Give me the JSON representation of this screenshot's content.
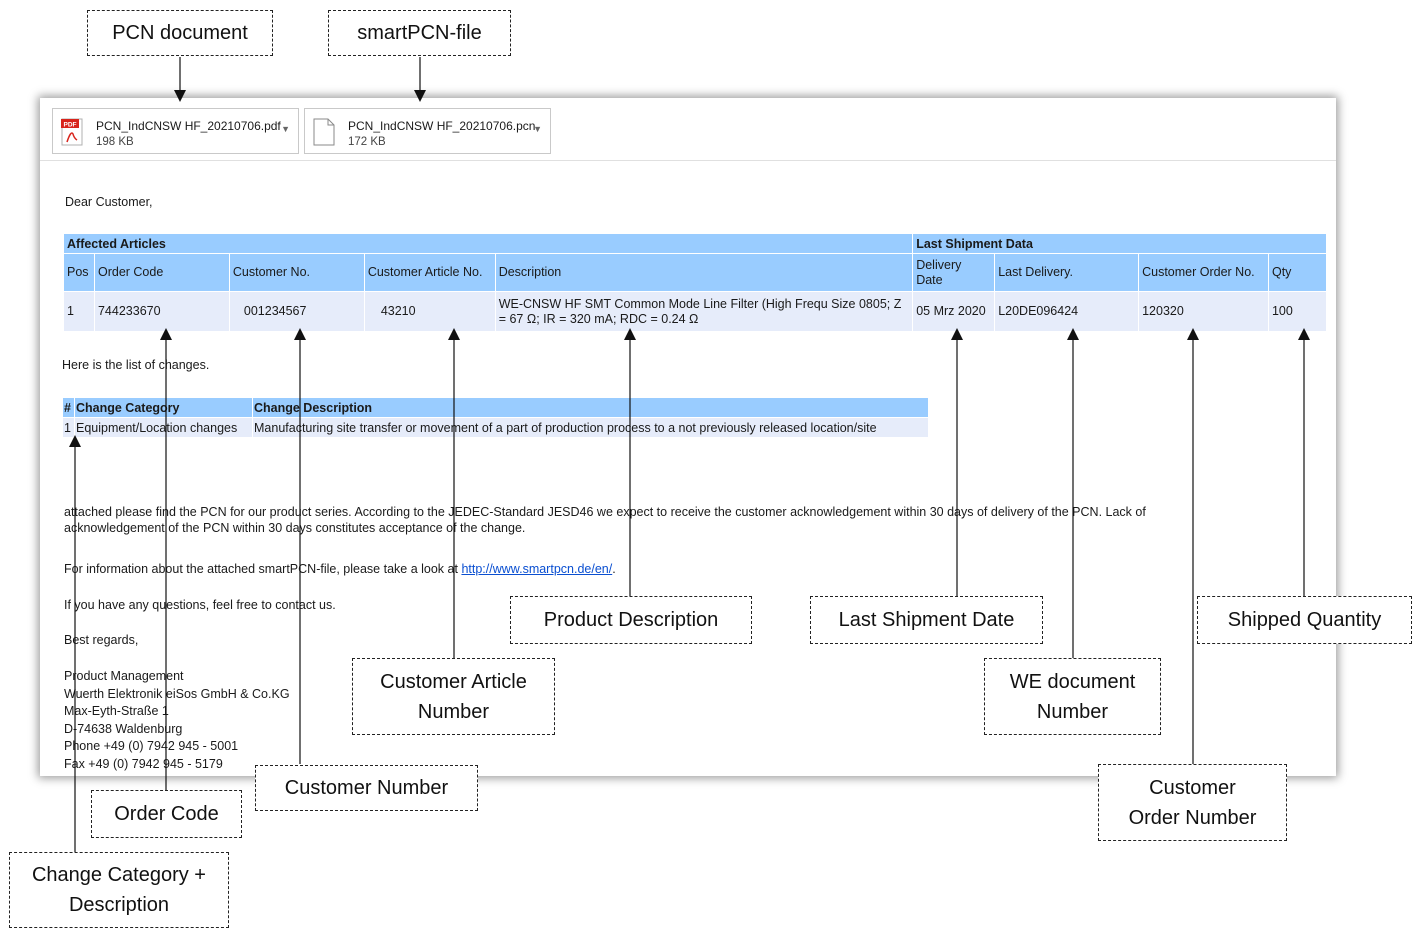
{
  "attachments": [
    {
      "name": "PCN_IndCNSW HF_20210706.pdf",
      "size": "198 KB",
      "icon": "pdf-icon",
      "icon_label": "PDF"
    },
    {
      "name": "PCN_IndCNSW HF_20210706.pcn",
      "size": "172 KB",
      "icon": "file-icon"
    }
  ],
  "greeting": "Dear Customer,",
  "affected": {
    "title": "Affected Articles",
    "shipment_title": "Last Shipment Data",
    "columns": [
      "Pos",
      "Order Code",
      "Customer No.",
      "Customer Article No.",
      "Description",
      "Delivery Date",
      "Last Delivery.",
      "Customer Order No.",
      "Qty"
    ],
    "rows": [
      {
        "pos": "1",
        "order_code": "744233670",
        "customer_no": "001234567",
        "customer_article_no": "43210",
        "description": "WE-CNSW HF SMT Common Mode Line Filter (High Frequ Size 0805; Z = 67 Ω; IR = 320 mA; RDC = 0.24 Ω",
        "delivery_date": "05 Mrz 2020",
        "last_delivery": "L20DE096424",
        "customer_order_no": "120320",
        "qty": "100"
      }
    ]
  },
  "changes_intro": "Here is the list of changes.",
  "changes": {
    "columns": [
      "#",
      "Change Category",
      "Change Description"
    ],
    "rows": [
      {
        "num": "1",
        "category": "Equipment/Location changes",
        "description": "Manufacturing site transfer or movement of a part of production process to a not previously released location/site"
      }
    ]
  },
  "body_text": {
    "para1_line1": "attached please find the PCN for our product series. According to the JEDEC-Standard JESD46 we expect to receive the customer acknowledgement within 30 days of delivery of the PCN. Lack of",
    "para1_line2": "acknowledgement of the PCN within 30 days constitutes acceptance of the change.",
    "para2_prefix": "For information about the attached smartPCN-file, please take a look at ",
    "para2_link": "http://www.smartpcn.de/en/",
    "para2_suffix": ".",
    "para3": "If you have any questions, feel free to contact us.",
    "regards": "Best regards,"
  },
  "signature": [
    "Product Management",
    "Wuerth Elektronik eiSos GmbH & Co.KG",
    "Max-Eyth-Straße 1",
    "D-74638 Waldenburg",
    "Phone +49 (0) 7942 945 - 5001",
    "Fax +49 (0) 7942 945 - 5179"
  ],
  "callouts": {
    "pcn_document": "PCN document",
    "smartpcn_file": "smartPCN-file",
    "product_description": "Product Description",
    "last_shipment_date": "Last Shipment Date",
    "shipped_quantity": "Shipped Quantity",
    "customer_article_number_1": "Customer Article",
    "customer_article_number_2": "Number",
    "we_document_number_1": "WE document",
    "we_document_number_2": "Number",
    "customer_number": "Customer Number",
    "order_code": "Order Code",
    "customer_order_number_1": "Customer",
    "customer_order_number_2": "Order Number",
    "change_category_1": "Change Category +",
    "change_category_2": "Description"
  }
}
